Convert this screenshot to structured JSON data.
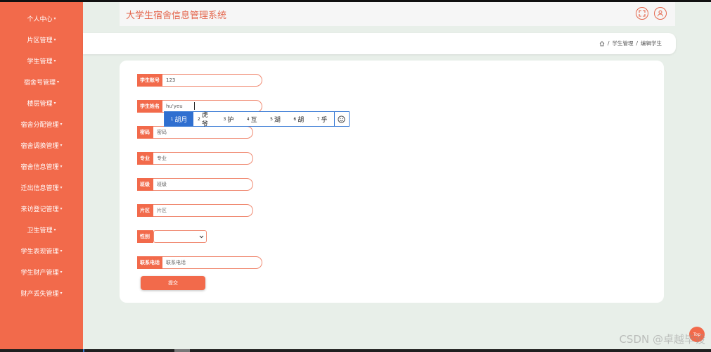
{
  "app_title": "大学生宿舍信息管理系统",
  "sidebar": {
    "items": [
      {
        "label": "个人中心"
      },
      {
        "label": "片区管理"
      },
      {
        "label": "学生管理"
      },
      {
        "label": "宿舍号管理"
      },
      {
        "label": "楼层管理"
      },
      {
        "label": "宿舍分配管理"
      },
      {
        "label": "宿舍调换管理"
      },
      {
        "label": "宿舍信息管理"
      },
      {
        "label": "迁出信息管理"
      },
      {
        "label": "来访登记管理"
      },
      {
        "label": "卫生管理"
      },
      {
        "label": "学生表现管理"
      },
      {
        "label": "学生财产管理"
      },
      {
        "label": "财产丢失管理"
      }
    ],
    "caret": "▾"
  },
  "breadcrumb": {
    "home_icon": "home-icon",
    "sep": "/",
    "items": [
      "学生管理",
      "编辑学生"
    ]
  },
  "form": {
    "account": {
      "label": "学生账号",
      "value": "123"
    },
    "name": {
      "label": "学生姓名",
      "value": "hu'yeu"
    },
    "password": {
      "label": "密码",
      "placeholder": "密码"
    },
    "major": {
      "label": "专业",
      "placeholder": "专业"
    },
    "class": {
      "label": "班级",
      "placeholder": "班级"
    },
    "area": {
      "label": "片区",
      "placeholder": "片区"
    },
    "gender": {
      "label": "性别",
      "selected": ""
    },
    "phone": {
      "label": "联系电话",
      "placeholder": "联系电话"
    },
    "submit_label": "提交"
  },
  "ime": {
    "candidates": [
      {
        "num": "1",
        "text": "胡月"
      },
      {
        "num": "2",
        "text": "虎爷"
      },
      {
        "num": "3",
        "text": "护"
      },
      {
        "num": "4",
        "text": "互"
      },
      {
        "num": "5",
        "text": "湖"
      },
      {
        "num": "6",
        "text": "胡"
      },
      {
        "num": "7",
        "text": "乎"
      }
    ],
    "emoji_icon": "emoji-icon"
  },
  "top_button": "Top",
  "watermark": "CSDN @卓越毕设",
  "colors": {
    "accent": "#f26a4b",
    "title": "#e4644a",
    "background": "#e8efe9",
    "ime_border": "#3a7bd5"
  }
}
